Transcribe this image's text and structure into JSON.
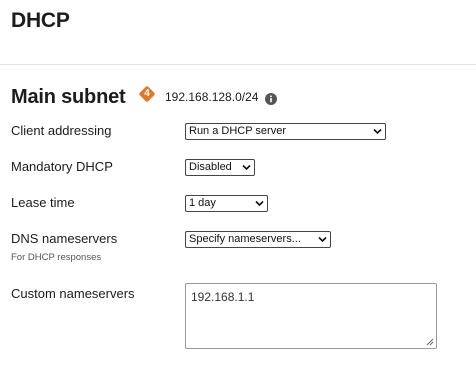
{
  "page": {
    "title": "DHCP"
  },
  "section": {
    "title": "Main subnet",
    "badge": "4",
    "subnet": "192.168.128.0/24",
    "info_icon": "info-circle-icon"
  },
  "fields": {
    "client_addressing": {
      "label": "Client addressing",
      "value": "Run a DHCP server"
    },
    "mandatory_dhcp": {
      "label": "Mandatory DHCP",
      "value": "Disabled"
    },
    "lease_time": {
      "label": "Lease time",
      "value": "1 day"
    },
    "dns_nameservers": {
      "label": "DNS nameservers",
      "sublabel": "For DHCP responses",
      "value": "Specify nameservers..."
    },
    "custom_nameservers": {
      "label": "Custom nameservers",
      "value": "192.168.1.1"
    }
  },
  "colors": {
    "badge": "#e0792c"
  }
}
